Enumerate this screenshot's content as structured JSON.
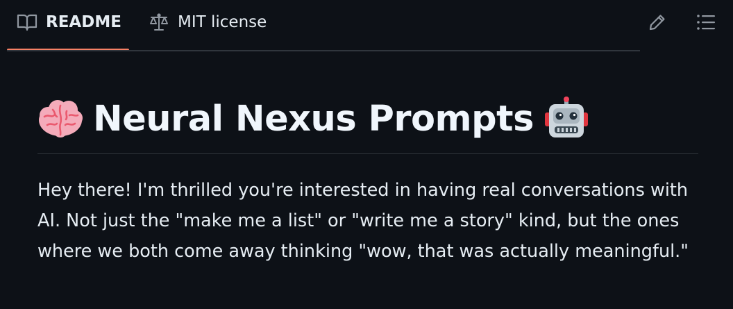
{
  "tabs": {
    "readme": {
      "label": "README",
      "icon": "book-icon",
      "selected": true
    },
    "license": {
      "label": "MIT license",
      "icon": "law-scale-icon"
    }
  },
  "actions": {
    "edit_icon": "pencil-icon",
    "outline_icon": "list-icon"
  },
  "readme": {
    "title": "Neural Nexus Prompts",
    "title_emoji_left": "brain-emoji",
    "title_emoji_right": "robot-emoji",
    "paragraph": "Hey there! I'm thrilled you're interested in having real conversations with AI. Not just the \"make me a list\" or \"write me a story\" kind, but the ones where we both come away thinking \"wow, that was actually meaningful.\""
  },
  "colors": {
    "background": "#0d1117",
    "text": "#e6edf3",
    "border": "#30363d",
    "active_tab_underline": "#f78166",
    "icon": "#9198a1"
  }
}
